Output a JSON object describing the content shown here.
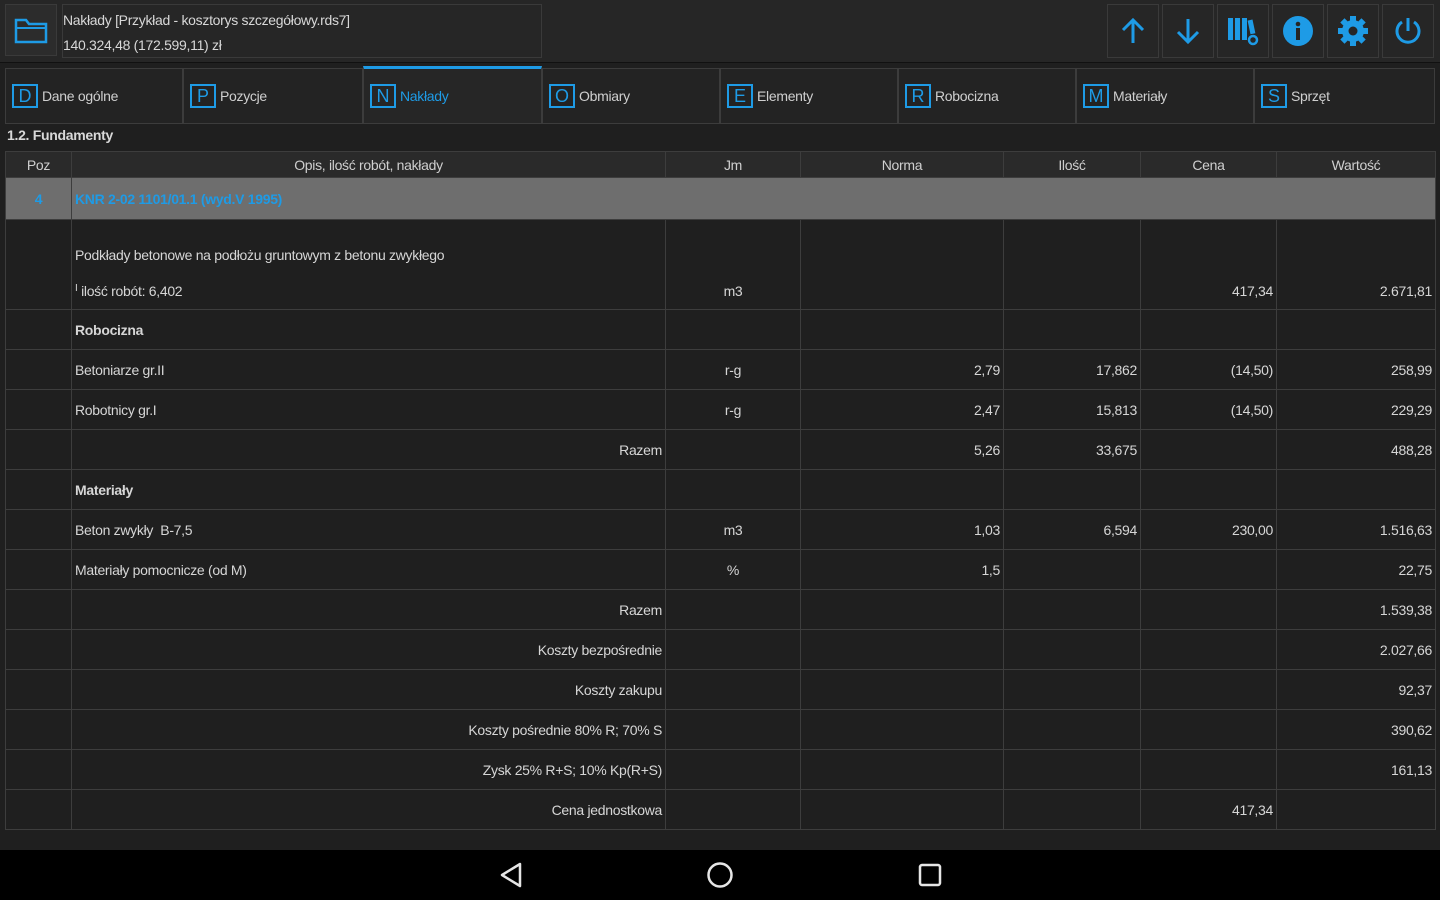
{
  "header": {
    "title": "Nakłady [Przykład - kosztorys szczegółowy.rds7]",
    "total": "140.324,48 (172.599,11) zł"
  },
  "icons": {
    "folder": "folder-icon",
    "up": "arrow-up-icon",
    "down": "arrow-down-icon",
    "library": "library-settings-icon",
    "info": "info-icon",
    "settings": "gear-icon",
    "power": "power-icon"
  },
  "tabs": [
    {
      "letter": "D",
      "label": "Dane ogólne"
    },
    {
      "letter": "P",
      "label": "Pozycje"
    },
    {
      "letter": "N",
      "label": "Nakłady"
    },
    {
      "letter": "O",
      "label": "Obmiary"
    },
    {
      "letter": "E",
      "label": "Elementy"
    },
    {
      "letter": "R",
      "label": "Robocizna"
    },
    {
      "letter": "M",
      "label": "Materiały"
    },
    {
      "letter": "S",
      "label": "Sprzęt"
    }
  ],
  "section": "1.2. Fundamenty",
  "columns": [
    "Poz",
    "Opis, ilość robót, nakłady",
    "Jm",
    "Norma",
    "Ilość",
    "Cena",
    "Wartość"
  ],
  "position": {
    "poz": "4",
    "code": "KNR 2-02 1101/01.1 (wyd.V 1995)"
  },
  "description": {
    "text": "Podkłady betonowe na podłożu gruntowym z betonu zwykłego",
    "mark": "I",
    "qty": "ilość robót: 6,402",
    "jm": "m3",
    "cena": "417,34",
    "wartosc": "2.671,81"
  },
  "groups": {
    "labor": "Robocizna",
    "materials": "Materiały"
  },
  "labor_rows": [
    {
      "opis": "Betoniarze gr.II",
      "jm": "r-g",
      "norma": "2,79",
      "ilosc": "17,862",
      "cena": "(14,50)",
      "wartosc": "258,99"
    },
    {
      "opis": "Robotnicy gr.I",
      "jm": "r-g",
      "norma": "2,47",
      "ilosc": "15,813",
      "cena": "(14,50)",
      "wartosc": "229,29"
    }
  ],
  "labor_total": {
    "opis": "Razem",
    "norma": "5,26",
    "ilosc": "33,675",
    "wartosc": "488,28"
  },
  "material_rows": [
    {
      "opis": "Beton zwykły  B-7,5",
      "jm": "m3",
      "norma": "1,03",
      "ilosc": "6,594",
      "cena": "230,00",
      "wartosc": "1.516,63"
    },
    {
      "opis": "Materiały pomocnicze (od M)",
      "jm": "%",
      "norma": "1,5",
      "ilosc": "",
      "cena": "",
      "wartosc": "22,75"
    }
  ],
  "material_total": {
    "opis": "Razem",
    "wartosc": "1.539,38"
  },
  "summary": [
    {
      "opis": "Koszty bezpośrednie",
      "cena": "",
      "wartosc": "2.027,66"
    },
    {
      "opis": "Koszty zakupu",
      "cena": "",
      "wartosc": "92,37"
    },
    {
      "opis": "Koszty pośrednie 80% R; 70% S",
      "cena": "",
      "wartosc": "390,62"
    },
    {
      "opis": "Zysk 25% R+S; 10% Kp(R+S)",
      "cena": "",
      "wartosc": "161,13"
    },
    {
      "opis": "Cena jednostkowa",
      "cena": "417,34",
      "wartosc": ""
    }
  ],
  "colors": {
    "accent": "#1e9be6",
    "background": "#1f1f1f",
    "row_highlight": "#6e6e6e"
  }
}
